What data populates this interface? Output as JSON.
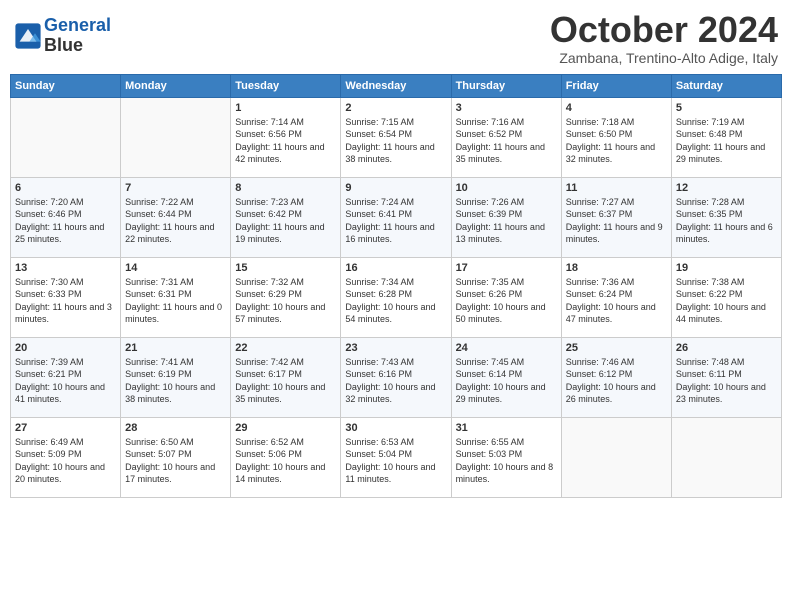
{
  "header": {
    "logo_line1": "General",
    "logo_line2": "Blue",
    "month": "October 2024",
    "location": "Zambana, Trentino-Alto Adige, Italy"
  },
  "days_of_week": [
    "Sunday",
    "Monday",
    "Tuesday",
    "Wednesday",
    "Thursday",
    "Friday",
    "Saturday"
  ],
  "weeks": [
    [
      {
        "num": "",
        "info": ""
      },
      {
        "num": "",
        "info": ""
      },
      {
        "num": "1",
        "info": "Sunrise: 7:14 AM\nSunset: 6:56 PM\nDaylight: 11 hours and 42 minutes."
      },
      {
        "num": "2",
        "info": "Sunrise: 7:15 AM\nSunset: 6:54 PM\nDaylight: 11 hours and 38 minutes."
      },
      {
        "num": "3",
        "info": "Sunrise: 7:16 AM\nSunset: 6:52 PM\nDaylight: 11 hours and 35 minutes."
      },
      {
        "num": "4",
        "info": "Sunrise: 7:18 AM\nSunset: 6:50 PM\nDaylight: 11 hours and 32 minutes."
      },
      {
        "num": "5",
        "info": "Sunrise: 7:19 AM\nSunset: 6:48 PM\nDaylight: 11 hours and 29 minutes."
      }
    ],
    [
      {
        "num": "6",
        "info": "Sunrise: 7:20 AM\nSunset: 6:46 PM\nDaylight: 11 hours and 25 minutes."
      },
      {
        "num": "7",
        "info": "Sunrise: 7:22 AM\nSunset: 6:44 PM\nDaylight: 11 hours and 22 minutes."
      },
      {
        "num": "8",
        "info": "Sunrise: 7:23 AM\nSunset: 6:42 PM\nDaylight: 11 hours and 19 minutes."
      },
      {
        "num": "9",
        "info": "Sunrise: 7:24 AM\nSunset: 6:41 PM\nDaylight: 11 hours and 16 minutes."
      },
      {
        "num": "10",
        "info": "Sunrise: 7:26 AM\nSunset: 6:39 PM\nDaylight: 11 hours and 13 minutes."
      },
      {
        "num": "11",
        "info": "Sunrise: 7:27 AM\nSunset: 6:37 PM\nDaylight: 11 hours and 9 minutes."
      },
      {
        "num": "12",
        "info": "Sunrise: 7:28 AM\nSunset: 6:35 PM\nDaylight: 11 hours and 6 minutes."
      }
    ],
    [
      {
        "num": "13",
        "info": "Sunrise: 7:30 AM\nSunset: 6:33 PM\nDaylight: 11 hours and 3 minutes."
      },
      {
        "num": "14",
        "info": "Sunrise: 7:31 AM\nSunset: 6:31 PM\nDaylight: 11 hours and 0 minutes."
      },
      {
        "num": "15",
        "info": "Sunrise: 7:32 AM\nSunset: 6:29 PM\nDaylight: 10 hours and 57 minutes."
      },
      {
        "num": "16",
        "info": "Sunrise: 7:34 AM\nSunset: 6:28 PM\nDaylight: 10 hours and 54 minutes."
      },
      {
        "num": "17",
        "info": "Sunrise: 7:35 AM\nSunset: 6:26 PM\nDaylight: 10 hours and 50 minutes."
      },
      {
        "num": "18",
        "info": "Sunrise: 7:36 AM\nSunset: 6:24 PM\nDaylight: 10 hours and 47 minutes."
      },
      {
        "num": "19",
        "info": "Sunrise: 7:38 AM\nSunset: 6:22 PM\nDaylight: 10 hours and 44 minutes."
      }
    ],
    [
      {
        "num": "20",
        "info": "Sunrise: 7:39 AM\nSunset: 6:21 PM\nDaylight: 10 hours and 41 minutes."
      },
      {
        "num": "21",
        "info": "Sunrise: 7:41 AM\nSunset: 6:19 PM\nDaylight: 10 hours and 38 minutes."
      },
      {
        "num": "22",
        "info": "Sunrise: 7:42 AM\nSunset: 6:17 PM\nDaylight: 10 hours and 35 minutes."
      },
      {
        "num": "23",
        "info": "Sunrise: 7:43 AM\nSunset: 6:16 PM\nDaylight: 10 hours and 32 minutes."
      },
      {
        "num": "24",
        "info": "Sunrise: 7:45 AM\nSunset: 6:14 PM\nDaylight: 10 hours and 29 minutes."
      },
      {
        "num": "25",
        "info": "Sunrise: 7:46 AM\nSunset: 6:12 PM\nDaylight: 10 hours and 26 minutes."
      },
      {
        "num": "26",
        "info": "Sunrise: 7:48 AM\nSunset: 6:11 PM\nDaylight: 10 hours and 23 minutes."
      }
    ],
    [
      {
        "num": "27",
        "info": "Sunrise: 6:49 AM\nSunset: 5:09 PM\nDaylight: 10 hours and 20 minutes."
      },
      {
        "num": "28",
        "info": "Sunrise: 6:50 AM\nSunset: 5:07 PM\nDaylight: 10 hours and 17 minutes."
      },
      {
        "num": "29",
        "info": "Sunrise: 6:52 AM\nSunset: 5:06 PM\nDaylight: 10 hours and 14 minutes."
      },
      {
        "num": "30",
        "info": "Sunrise: 6:53 AM\nSunset: 5:04 PM\nDaylight: 10 hours and 11 minutes."
      },
      {
        "num": "31",
        "info": "Sunrise: 6:55 AM\nSunset: 5:03 PM\nDaylight: 10 hours and 8 minutes."
      },
      {
        "num": "",
        "info": ""
      },
      {
        "num": "",
        "info": ""
      }
    ]
  ]
}
